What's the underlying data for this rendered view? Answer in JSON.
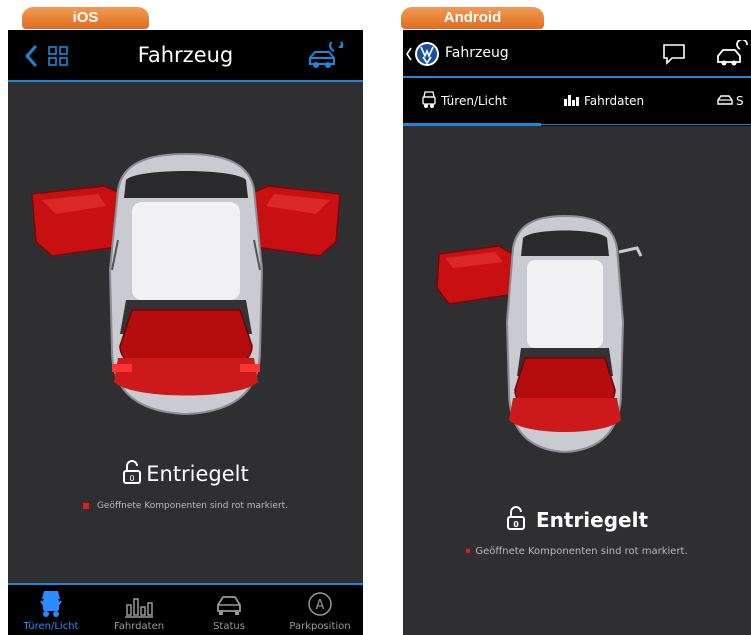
{
  "ios": {
    "badge": "iOS",
    "title": "Fahrzeug",
    "lock_status": "Entriegelt",
    "legend": "Geöffnete Komponenten sind rot markiert.",
    "tabs": [
      {
        "label": "Türen/Licht",
        "icon": "car-doors-icon",
        "active": true
      },
      {
        "label": "Fahrdaten",
        "icon": "bar-chart-icon",
        "active": false
      },
      {
        "label": "Status",
        "icon": "car-icon",
        "active": false
      },
      {
        "label": "Parkposition",
        "icon": "parking-a-icon",
        "active": false
      }
    ]
  },
  "android": {
    "badge": "Android",
    "title": "Fahrzeug",
    "lock_status": "Entriegelt",
    "legend": "Geöffnete Komponenten sind rot markiert.",
    "tabs": [
      {
        "label": "Türen/Licht",
        "icon": "car-doors-icon",
        "active": true
      },
      {
        "label": "Fahrdaten",
        "icon": "bar-chart-icon",
        "active": false
      },
      {
        "label": "S",
        "icon": "car-icon",
        "active": false
      }
    ]
  },
  "colors": {
    "accent": "#1e86d8",
    "open_component": "#e01b1b",
    "badge": "#e87a2b"
  }
}
